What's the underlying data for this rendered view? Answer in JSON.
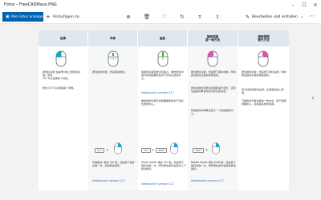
{
  "window": {
    "title": "Fotos – FreeCADMaus.PNG",
    "minimize": "–",
    "maximize": "☐",
    "close": "✕"
  },
  "toolbar": {
    "all_photos_label": "Alle Fotos anzeigen",
    "add_label": "Hinzufügen zu",
    "edit_label": "Bearbeiten und erstellen",
    "icons": [
      "zoom-icon",
      "delete-icon",
      "favorite-icon",
      "rotate-icon",
      "crop-icon",
      "share-icon",
      "more-icon"
    ]
  },
  "doc": {
    "headers": [
      "选择",
      "平移",
      "缩放",
      "旋转视图\n第一种方法",
      "旋转视图\n替代方法"
    ],
    "col1_text": [
      "按鼠标左键 在操作对象上按鼠标左键。按住",
      "Ctrl 可以选择多个对象。",
      "按住 Ctrl 可以选择多个对象。"
    ],
    "col2_text": [
      "按住鼠标中键，然后移动鼠标。"
    ],
    "col3_text": [
      "使用鼠标滚轮放大和缩小。单击鼠标中键可将视图重新集中于光标位置的中心。",
      "Introduced in version 0.17",
      "单击鼠标中键可将视图重新集中于光标位置的中心。"
    ],
    "col4_text": [
      "按住鼠标左键，然后按下鼠标中键，同时按住鼠标左键并移动鼠标。",
      "鼠标中键的手势将对旋转进行定位，该定位由鼠标单击时的光标位置决定。",
      "所选鼠标中键单击定义一个新的旋转中心。"
    ],
    "col5_text": [
      "按住鼠标中键，然后按下鼠标左键，同时按住鼠标中键并移动鼠标。",
      "该方法使用鼠标右键，在某些系统上使用。",
      "习惯用法代替功能的一种方式，用于旋转视图中心，在某些系统中使用。"
    ],
    "keys": {
      "ctrl": "Ctrl",
      "shift": "Shift",
      "zoom_keys_label": "Ctrl + Shift",
      "rot_keys_label": "Shift"
    },
    "bottom_texts": {
      "c2": "平移模式: 按住 Ctrl 键，然后按下鼠标右键一次，然后移动鼠标。",
      "c2_ver": "Introduced in version 0.17",
      "c3": "Zoom mode: 按住 Ctrl 键，然后按下鼠标右键一次，同时按住鼠标右键并上下移动鼠标。",
      "c3_ver": "Introduced in version 0.17",
      "c4": "Rotate mode: 按住 Shift 键，然后按下鼠标右键一次，同时按住鼠标右键并移动鼠标。",
      "c4_ver": "Introduced in version 0.17"
    }
  },
  "colors": {
    "accent": "#0063b1",
    "mouse_highlight_cyan": "#00b0d8",
    "mouse_highlight_pink": "#e64bbf",
    "mouse_highlight_green": "#37b44a",
    "header_bg": "#dfe7ef"
  }
}
